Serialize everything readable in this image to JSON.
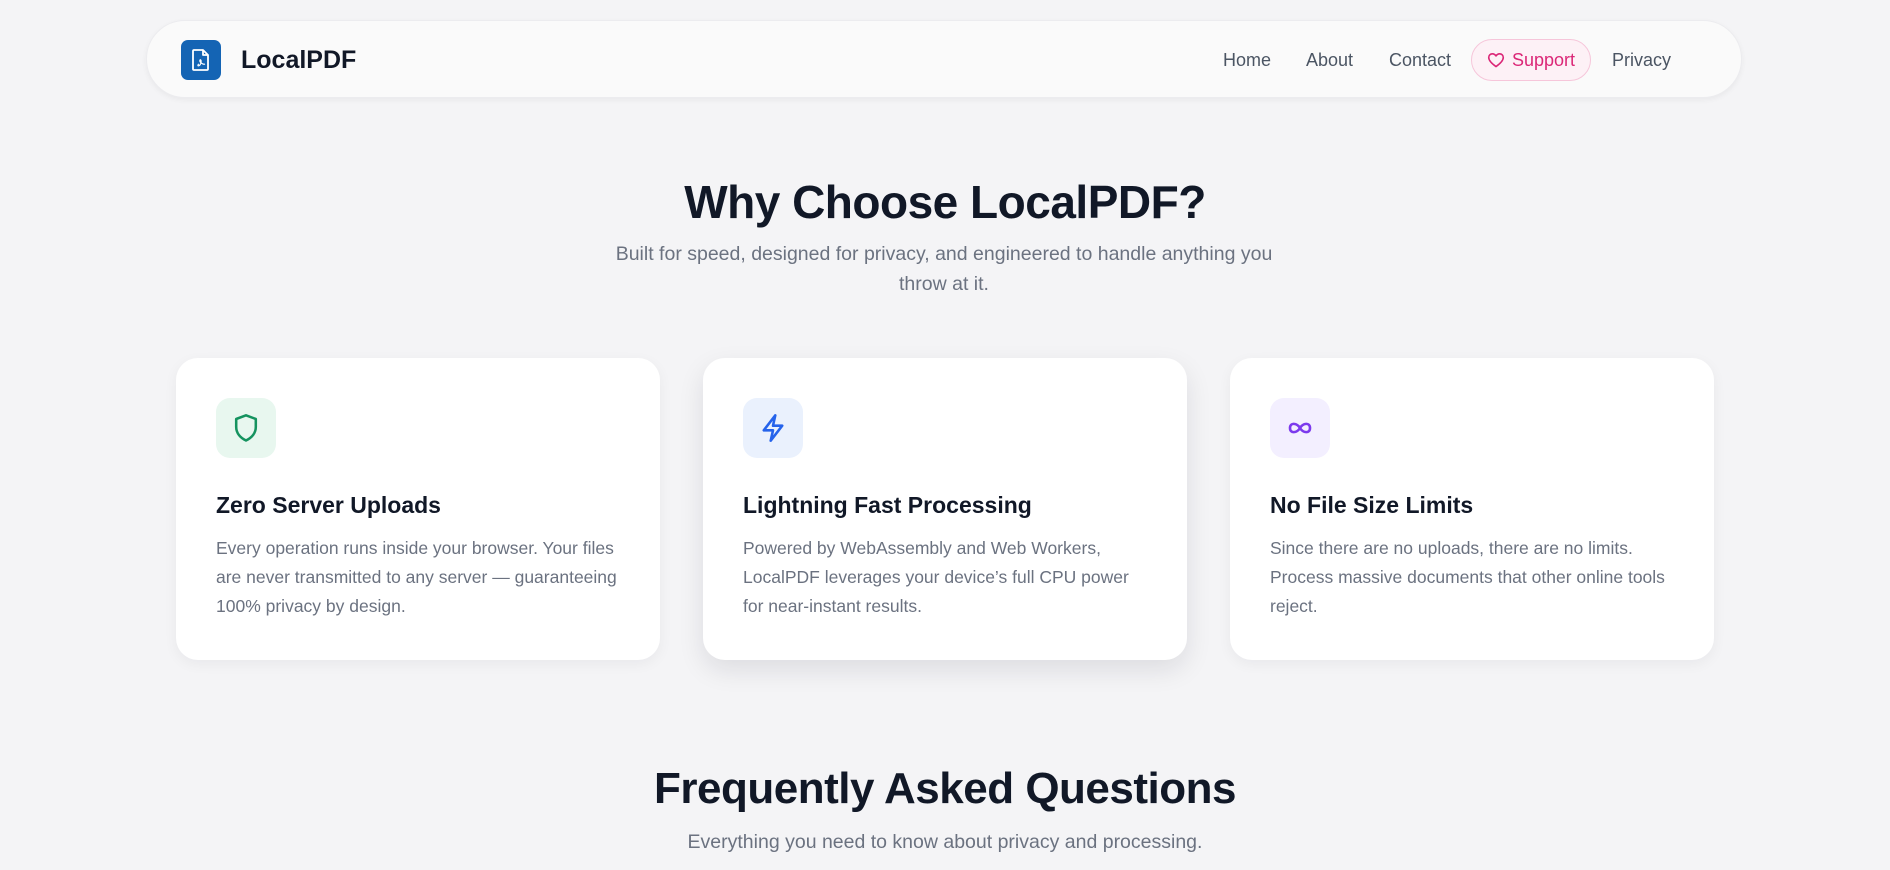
{
  "navbar": {
    "brand": "LocalPDF",
    "links": {
      "home": "Home",
      "about": "About",
      "contact": "Contact",
      "support": "Support",
      "privacy": "Privacy"
    }
  },
  "why": {
    "title": "Why Choose LocalPDF?",
    "subtitle": "Built for speed, designed for privacy, and engineered to handle anything you throw at it."
  },
  "features": [
    {
      "icon": "shield-icon",
      "title": "Zero Server Uploads",
      "description": "Every operation runs inside your browser. Your files are never transmitted to any server — guaranteeing 100% privacy by design."
    },
    {
      "icon": "lightning-icon",
      "title": "Lightning Fast Processing",
      "description": "Powered by WebAssembly and Web Workers, LocalPDF leverages your device’s full CPU power for near-instant results."
    },
    {
      "icon": "infinity-icon",
      "title": "No File Size Limits",
      "description": "Since there are no uploads, there are no limits. Process massive documents that other online tools reject."
    }
  ],
  "faq": {
    "title": "Frequently Asked Questions",
    "subtitle": "Everything you need to know about privacy and processing."
  },
  "colors": {
    "background": "#f4f4f6",
    "brand_blue": "#1464b4",
    "support_pink": "#db2777",
    "shield_green": "#15935f",
    "lightning_blue": "#2563eb",
    "infinity_purple": "#7c3aed"
  }
}
